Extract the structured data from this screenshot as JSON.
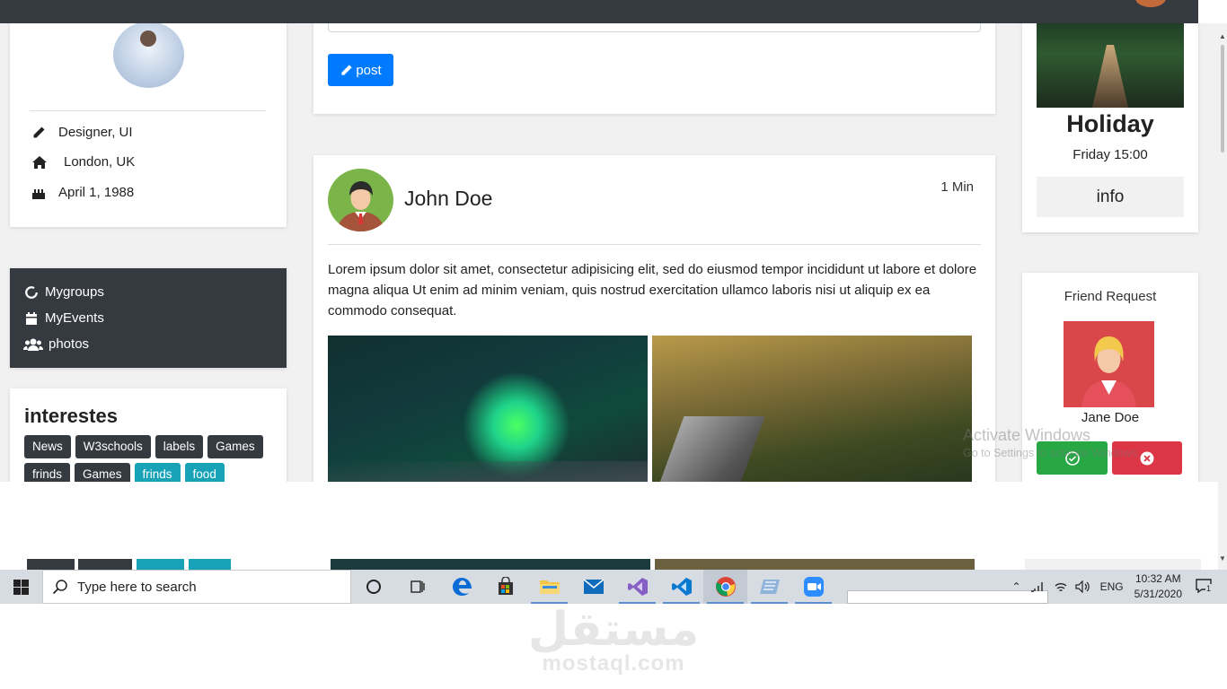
{
  "profile": {
    "job": "Designer, UI",
    "location": "London, UK",
    "birthday": "April 1, 1988"
  },
  "menu": {
    "items": [
      {
        "label": "Mygroups",
        "icon": "circle-notch-icon"
      },
      {
        "label": "MyEvents",
        "icon": "calendar-icon"
      },
      {
        "label": "photos",
        "icon": "users-icon"
      }
    ]
  },
  "interests": {
    "title": "interestes",
    "tags": [
      {
        "label": "News",
        "color": "#343a40"
      },
      {
        "label": "W3schools",
        "color": "#343a40"
      },
      {
        "label": "labels",
        "color": "#343a40"
      },
      {
        "label": "Games",
        "color": "#343a40"
      },
      {
        "label": "frinds",
        "color": "#343a40"
      },
      {
        "label": "Games",
        "color": "#343a40"
      },
      {
        "label": "frinds",
        "color": "#17a2b8"
      },
      {
        "label": "food",
        "color": "#17a2b8"
      }
    ]
  },
  "compose": {
    "post_label": "post"
  },
  "post": {
    "author": "John Doe",
    "time": "1 Min",
    "body": "Lorem ipsum dolor sit amet, consectetur adipisicing elit, sed do eiusmod tempor incididunt ut labore et dolore magna aliqua Ut enim ad minim veniam, quis nostrud exercitation ullamco laboris nisi ut aliquip ex ea commodo consequat."
  },
  "event": {
    "title": "Holiday",
    "when": "Friday 15:00",
    "info_label": "info"
  },
  "friend_request": {
    "heading": "Friend Request",
    "name": "Jane Doe"
  },
  "watermark": {
    "line1": "Activate Windows",
    "line2": "Go to Settings to activate Windows."
  },
  "taskbar": {
    "search_placeholder": "Type here to search",
    "language": "ENG",
    "time": "10:32 AM",
    "date": "5/31/2020",
    "notifications": "1"
  },
  "brand": {
    "arabic": "مستقل",
    "latin": "mostaql.com"
  },
  "colors": {
    "primary": "#007bff",
    "dark": "#343a40",
    "success": "#28a745",
    "danger": "#dc3545",
    "info": "#17a2b8"
  }
}
